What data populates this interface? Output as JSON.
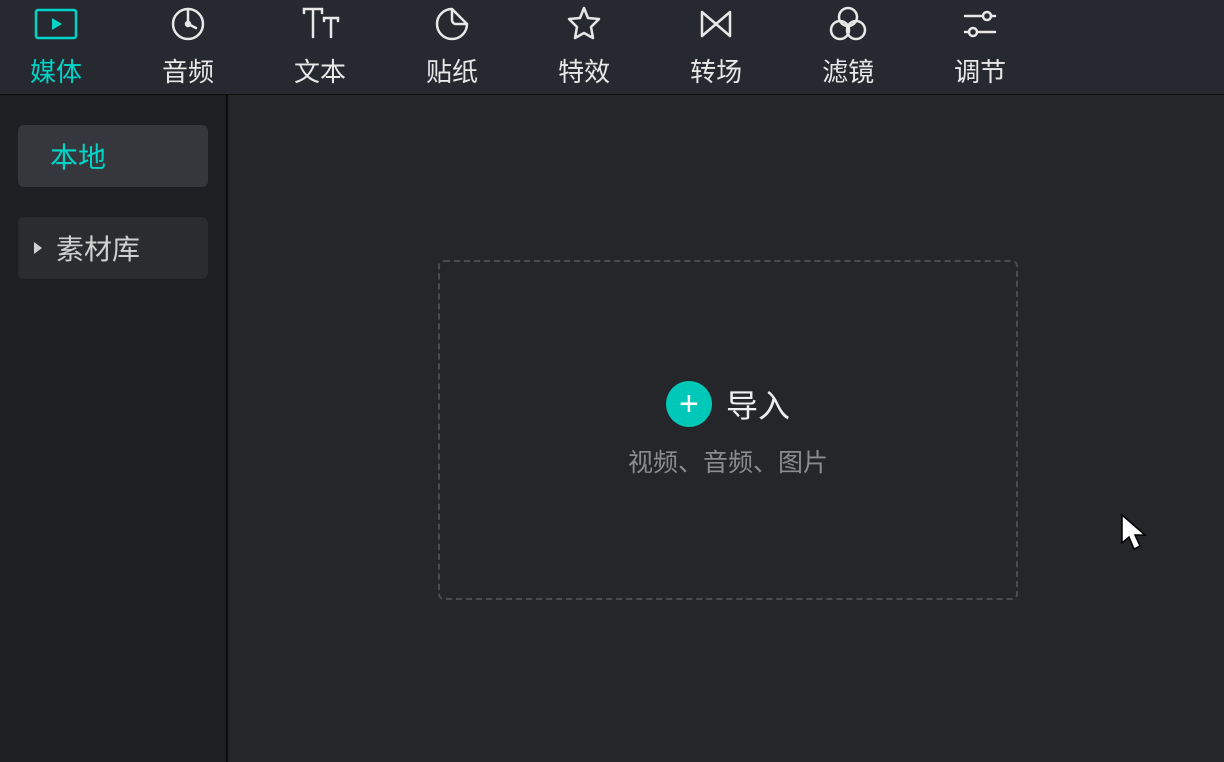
{
  "toolbar": {
    "items": [
      {
        "label": "媒体",
        "icon": "media-icon",
        "active": true
      },
      {
        "label": "音频",
        "icon": "audio-icon",
        "active": false
      },
      {
        "label": "文本",
        "icon": "text-icon",
        "active": false
      },
      {
        "label": "贴纸",
        "icon": "sticker-icon",
        "active": false
      },
      {
        "label": "特效",
        "icon": "effects-icon",
        "active": false
      },
      {
        "label": "转场",
        "icon": "transition-icon",
        "active": false
      },
      {
        "label": "滤镜",
        "icon": "filter-icon",
        "active": false
      },
      {
        "label": "调节",
        "icon": "adjust-icon",
        "active": false
      }
    ]
  },
  "sidebar": {
    "items": [
      {
        "label": "本地",
        "active": true,
        "expandable": false
      },
      {
        "label": "素材库",
        "active": false,
        "expandable": true
      }
    ]
  },
  "dropzone": {
    "title": "导入",
    "subtitle": "视频、音频、图片"
  },
  "colors": {
    "accent": "#00d4c8",
    "bg_toolbar": "#26292f",
    "bg_sidebar": "#1e1f22",
    "bg_main": "#24262a"
  }
}
